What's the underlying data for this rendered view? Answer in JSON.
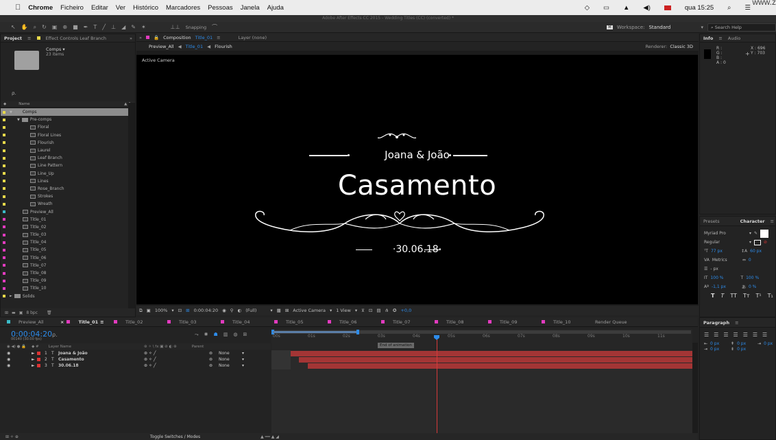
{
  "menubar": {
    "apple": "",
    "app": "Chrome",
    "items": [
      "Ficheiro",
      "Editar",
      "Ver",
      "Histórico",
      "Marcadores",
      "Pessoas",
      "Janela",
      "Ajuda"
    ],
    "clock": "qua 15:25",
    "watermark": "www.z"
  },
  "window_title": "Adobe After Effects CC 2015 - Wedding Titles (CC) (converted) *",
  "toolbar": {
    "snapping": "Snapping",
    "workspace_label": "Workspace:",
    "workspace_value": "Standard",
    "search_help": "Search Help"
  },
  "project_panel": {
    "tabs": [
      "Project",
      "Effect Controls Leaf Branch"
    ],
    "selected_name": "Comps ▾",
    "selected_sub": "23 items",
    "search_glyph": "ρ.",
    "column_name": "Name",
    "items": [
      {
        "name": "Comps",
        "type": "folder",
        "indent": 0,
        "color": "#e8d94a",
        "selected": true,
        "tri": "▼"
      },
      {
        "name": "Pre-comps",
        "type": "folder",
        "indent": 1,
        "color": "#e8d94a",
        "tri": "▼"
      },
      {
        "name": "Floral",
        "type": "comp",
        "indent": 2,
        "color": "#e8d94a"
      },
      {
        "name": "Floral Lines",
        "type": "comp",
        "indent": 2,
        "color": "#e8d94a"
      },
      {
        "name": "Flourish",
        "type": "comp",
        "indent": 2,
        "color": "#e8d94a"
      },
      {
        "name": "Laurel",
        "type": "comp",
        "indent": 2,
        "color": "#e8d94a"
      },
      {
        "name": "Leaf Branch",
        "type": "comp",
        "indent": 2,
        "color": "#e8d94a"
      },
      {
        "name": "Line Pattern",
        "type": "comp",
        "indent": 2,
        "color": "#e8d94a"
      },
      {
        "name": "Line_Up",
        "type": "comp",
        "indent": 2,
        "color": "#e8d94a"
      },
      {
        "name": "Lines",
        "type": "comp",
        "indent": 2,
        "color": "#e8d94a"
      },
      {
        "name": "Rose_Branch",
        "type": "comp",
        "indent": 2,
        "color": "#e8d94a"
      },
      {
        "name": "Strokes",
        "type": "comp",
        "indent": 2,
        "color": "#e8d94a"
      },
      {
        "name": "Wreath",
        "type": "comp",
        "indent": 2,
        "color": "#e8d94a"
      },
      {
        "name": "Preview_All",
        "type": "comp",
        "indent": 1,
        "color": "#3bbcc9"
      },
      {
        "name": "Title_01",
        "type": "comp",
        "indent": 1,
        "color": "#e23bbf"
      },
      {
        "name": "Title_02",
        "type": "comp",
        "indent": 1,
        "color": "#e23bbf"
      },
      {
        "name": "Title_03",
        "type": "comp",
        "indent": 1,
        "color": "#e23bbf"
      },
      {
        "name": "Title_04",
        "type": "comp",
        "indent": 1,
        "color": "#e23bbf"
      },
      {
        "name": "Title_05",
        "type": "comp",
        "indent": 1,
        "color": "#e23bbf"
      },
      {
        "name": "Title_06",
        "type": "comp",
        "indent": 1,
        "color": "#e23bbf"
      },
      {
        "name": "Title_07",
        "type": "comp",
        "indent": 1,
        "color": "#e23bbf"
      },
      {
        "name": "Title_08",
        "type": "comp",
        "indent": 1,
        "color": "#e23bbf"
      },
      {
        "name": "Title_09",
        "type": "comp",
        "indent": 1,
        "color": "#e23bbf"
      },
      {
        "name": "Title_10",
        "type": "comp",
        "indent": 1,
        "color": "#e23bbf"
      },
      {
        "name": "Solids",
        "type": "folder",
        "indent": 0,
        "color": "#e8d94a",
        "tri": "►"
      }
    ],
    "bpc": "8 bpc"
  },
  "composition_panel": {
    "tab_label": "Composition",
    "tab_comp": "Title_01",
    "layer_label": "Layer (none)",
    "breadcrumbs": [
      "Preview_All",
      "Title_01",
      "Flourish"
    ],
    "renderer_label": "Renderer:",
    "renderer_value": "Classic 3D",
    "active_camera": "Active Camera",
    "viewer": {
      "names": "Joana & João",
      "title": "Casamento",
      "date": "30.06.18"
    },
    "controls": {
      "zoom": "100%",
      "timecode": "0:00:04:20",
      "resolution": "(Full)",
      "camera": "Active Camera",
      "views": "1 View",
      "exposure": "+0,0"
    }
  },
  "timeline": {
    "tabs": [
      {
        "label": "Preview_All",
        "color": "#3bbcc9"
      },
      {
        "label": "Title_01",
        "color": "#e23bbf",
        "active": true
      },
      {
        "label": "Title_02",
        "color": "#e23bbf"
      },
      {
        "label": "Title_03",
        "color": "#e23bbf"
      },
      {
        "label": "Title_04",
        "color": "#e23bbf"
      },
      {
        "label": "Title_05",
        "color": "#e23bbf"
      },
      {
        "label": "Title_06",
        "color": "#e23bbf"
      },
      {
        "label": "Title_07",
        "color": "#e23bbf"
      },
      {
        "label": "Title_08",
        "color": "#e23bbf"
      },
      {
        "label": "Title_09",
        "color": "#e23bbf"
      },
      {
        "label": "Title_10",
        "color": "#e23bbf"
      },
      {
        "label": "Render Queue",
        "color": ""
      }
    ],
    "timecode": "0:00:04:20",
    "frames": "00140 (30.00 fps)",
    "col_layer_name": "Layer Name",
    "col_parent": "Parent",
    "layers": [
      {
        "num": "1",
        "name": "Joana & João",
        "parent": "None"
      },
      {
        "num": "2",
        "name": "Casamento",
        "parent": "None"
      },
      {
        "num": "3",
        "name": "30.06.18",
        "parent": "None"
      }
    ],
    "ruler": [
      "00s",
      "01s",
      "02s",
      "03s",
      "04s",
      "05s",
      "06s",
      "07s",
      "08s",
      "09s",
      "10s",
      "11s"
    ],
    "marker": "End of animation",
    "toggle": "Toggle Switches / Modes"
  },
  "info_panel": {
    "tabs": [
      "Info",
      "Audio"
    ],
    "r": "R :",
    "g": "G :",
    "b": "B :",
    "a": "A : 0",
    "x": "X : 696",
    "y": "Y : 703"
  },
  "character_panel": {
    "tabs": [
      "Presets",
      "Character"
    ],
    "font": "Myriad Pro",
    "style": "Regular",
    "size": "77 px",
    "leading": "60 px",
    "kerning": "Metrics",
    "tracking": "0",
    "stroke": "- px",
    "vscale": "100 %",
    "hscale": "100 %",
    "baseline": "-1,1 px",
    "tsume": "0 %",
    "text_styles": [
      "T",
      "T",
      "TT",
      "Tт",
      "T¹",
      "T₁"
    ]
  },
  "paragraph_panel": {
    "title": "Paragraph",
    "indent_values": [
      "0 px",
      "0 px",
      "0 px",
      "0 px",
      "0 px"
    ]
  },
  "colors": {
    "accent_blue": "#2d8ceb",
    "title_pink": "#e23bbf",
    "folder_yellow": "#e8d94a",
    "preview_cyan": "#3bbcc9",
    "layer_bar": "#a33535"
  }
}
